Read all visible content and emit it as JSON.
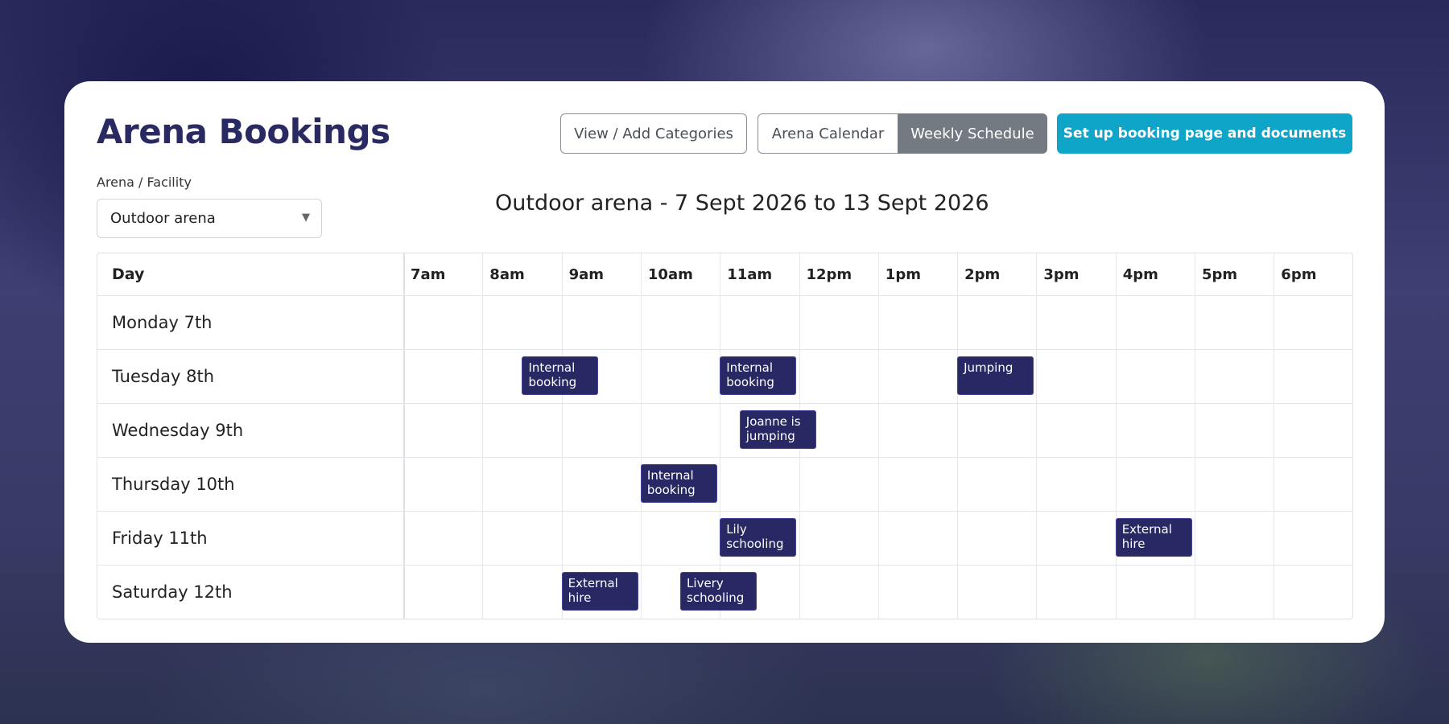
{
  "header": {
    "title": "Arena Bookings",
    "categories_button": "View / Add Categories",
    "calendar_button": "Arena Calendar",
    "weekly_button": "Weekly Schedule",
    "setup_button": "Set up booking page and documents"
  },
  "facility": {
    "label": "Arena / Facility",
    "selected": "Outdoor arena"
  },
  "schedule": {
    "range_title": "Outdoor arena - 7 Sept 2026 to 13 Sept 2026",
    "day_header": "Day",
    "hours": [
      "7am",
      "8am",
      "9am",
      "10am",
      "11am",
      "12pm",
      "1pm",
      "2pm",
      "3pm",
      "4pm",
      "5pm",
      "6pm"
    ],
    "days": [
      "Monday 7th",
      "Tuesday 8th",
      "Wednesday 9th",
      "Thursday 10th",
      "Friday 11th",
      "Saturday 12th"
    ],
    "bookings": [
      {
        "label": "Internal booking",
        "day": 1,
        "start": 8.5
      },
      {
        "label": "Internal booking",
        "day": 1,
        "start": 11
      },
      {
        "label": "Jumping",
        "day": 1,
        "start": 14
      },
      {
        "label": "Joanne is jumping",
        "day": 2,
        "start": 11.25
      },
      {
        "label": "Internal booking",
        "day": 3,
        "start": 10
      },
      {
        "label": "Lily schooling",
        "day": 4,
        "start": 11
      },
      {
        "label": "External hire",
        "day": 4,
        "start": 16
      },
      {
        "label": "External hire",
        "day": 5,
        "start": 9
      },
      {
        "label": "Livery schooling",
        "day": 5,
        "start": 10.5
      }
    ]
  }
}
